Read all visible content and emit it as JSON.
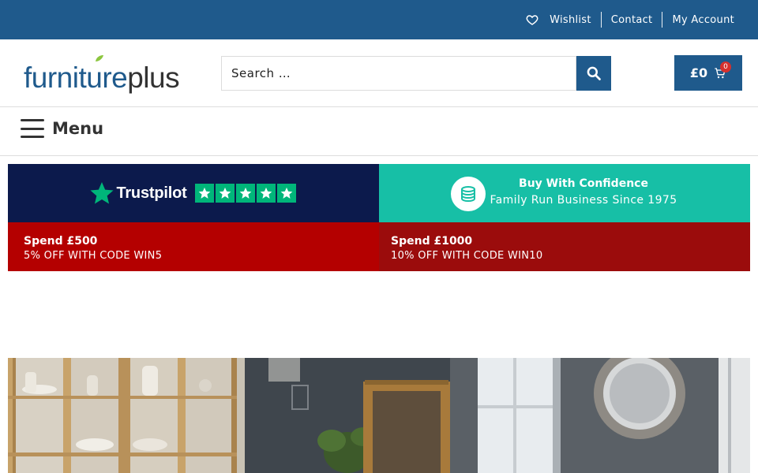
{
  "topbar": {
    "wishlist": "Wishlist",
    "contact": "Contact",
    "account": "My Account"
  },
  "header": {
    "logo_part1": "furniture",
    "logo_part2": "plus",
    "search_placeholder": "Search …",
    "cart_amount": "£0",
    "cart_count": "0"
  },
  "menu": {
    "label": "Menu"
  },
  "promo": {
    "trustpilot_label": "Trustpilot",
    "trustpilot_rating": 5,
    "confidence_title": "Buy With Confidence",
    "confidence_sub": "Family Run Business Since 1975",
    "offer1_title": "Spend £500",
    "offer1_code": "5% OFF WITH CODE WIN5",
    "offer2_title": "Spend £1000",
    "offer2_code": "10% OFF WITH CODE WIN10"
  },
  "colors": {
    "brand_blue": "#1f5a8c",
    "trustpilot_navy": "#0c1a4c",
    "trustpilot_green": "#00b67a",
    "confidence_teal": "#17bfa6",
    "offer_red": "#b40000",
    "offer_dark_red": "#9b0c0c",
    "badge_red": "#d6302d"
  },
  "icons": {
    "wishlist": "heart-icon",
    "search": "magnifier-icon",
    "cart": "cart-icon",
    "menu": "hamburger-icon",
    "confidence": "coins-icon",
    "trustpilot": "star-icon"
  }
}
